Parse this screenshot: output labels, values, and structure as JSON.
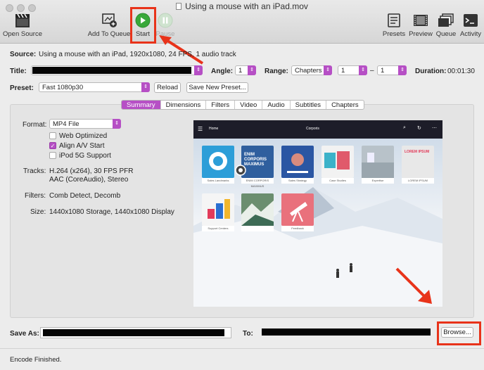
{
  "window": {
    "title": "Using a mouse with an iPad.mov"
  },
  "toolbar": {
    "open_source": "Open Source",
    "add_to_queue": "Add To Queue",
    "start": "Start",
    "pause": "Pause",
    "presets": "Presets",
    "preview": "Preview",
    "queue": "Queue",
    "activity": "Activity"
  },
  "source": {
    "label": "Source:",
    "value": "Using a mouse with an iPad, 1920x1080, 24 FPS, 1 audio track"
  },
  "title_row": {
    "label": "Title:",
    "angle_label": "Angle:",
    "angle_value": "1",
    "range_label": "Range:",
    "range_value": "Chapters",
    "range_from": "1",
    "range_dash": "–",
    "range_to": "1",
    "duration_label": "Duration:",
    "duration_value": "00:01:30"
  },
  "preset": {
    "label": "Preset:",
    "value": "Fast 1080p30",
    "reload": "Reload",
    "save_new": "Save New Preset..."
  },
  "tabs": [
    "Summary",
    "Dimensions",
    "Filters",
    "Video",
    "Audio",
    "Subtitles",
    "Chapters"
  ],
  "summary": {
    "format_label": "Format:",
    "format_value": "MP4 File",
    "web_optimized": "Web Optimized",
    "align_av": "Align A/V Start",
    "ipod": "iPod 5G Support",
    "tracks_label": "Tracks:",
    "tracks_line1": "H.264 (x264), 30 FPS PFR",
    "tracks_line2": "AAC (CoreAudio), Stereo",
    "filters_label": "Filters:",
    "filters_value": "Comb Detect, Decomb",
    "size_label": "Size:",
    "size_value": "1440x1080 Storage, 1440x1080 Display"
  },
  "preview_screen": {
    "home": "Home",
    "center": "Corporis",
    "tiles": [
      "Sales Landmarks",
      "ENIM CORPORIS MAXIMUS",
      "Sales Strategy",
      "Case Studies",
      "Expertise",
      "LOREM IPSUM",
      "Support Centers",
      "",
      "Feedback"
    ],
    "tile2_text": "ENIM CORPORIS MAXIMUS",
    "tile6_text": "LOREM IPSUM"
  },
  "save": {
    "label": "Save As:",
    "to_label": "To:",
    "browse": "Browse..."
  },
  "status": "Encode Finished.",
  "colors": {
    "accent": "#b64fc5",
    "highlight": "#e8331a",
    "start_green": "#39a83a"
  }
}
